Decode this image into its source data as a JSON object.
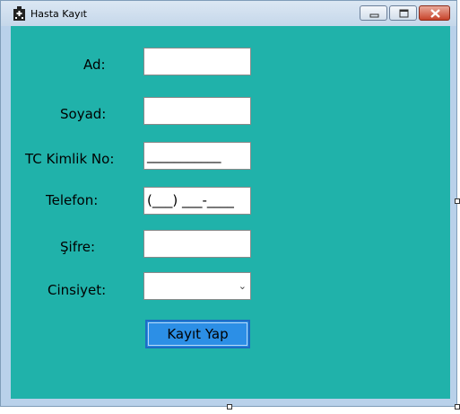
{
  "window": {
    "title": "Hasta Kayıt",
    "icon": "hospital-icon"
  },
  "form": {
    "ad_label": "Ad:",
    "soyad_label": "Soyad:",
    "tc_label": "TC Kimlik No:",
    "tc_mask": "___________",
    "telefon_label": "Telefon:",
    "telefon_mask": "(___) ___-____",
    "sifre_label": "Şifre:",
    "cinsiyet_label": "Cinsiyet:",
    "cinsiyet_value": "",
    "submit_label": "Kayıt Yap"
  },
  "colors": {
    "client_background": "#20b2aa",
    "button_background": "#2c8fe6"
  }
}
